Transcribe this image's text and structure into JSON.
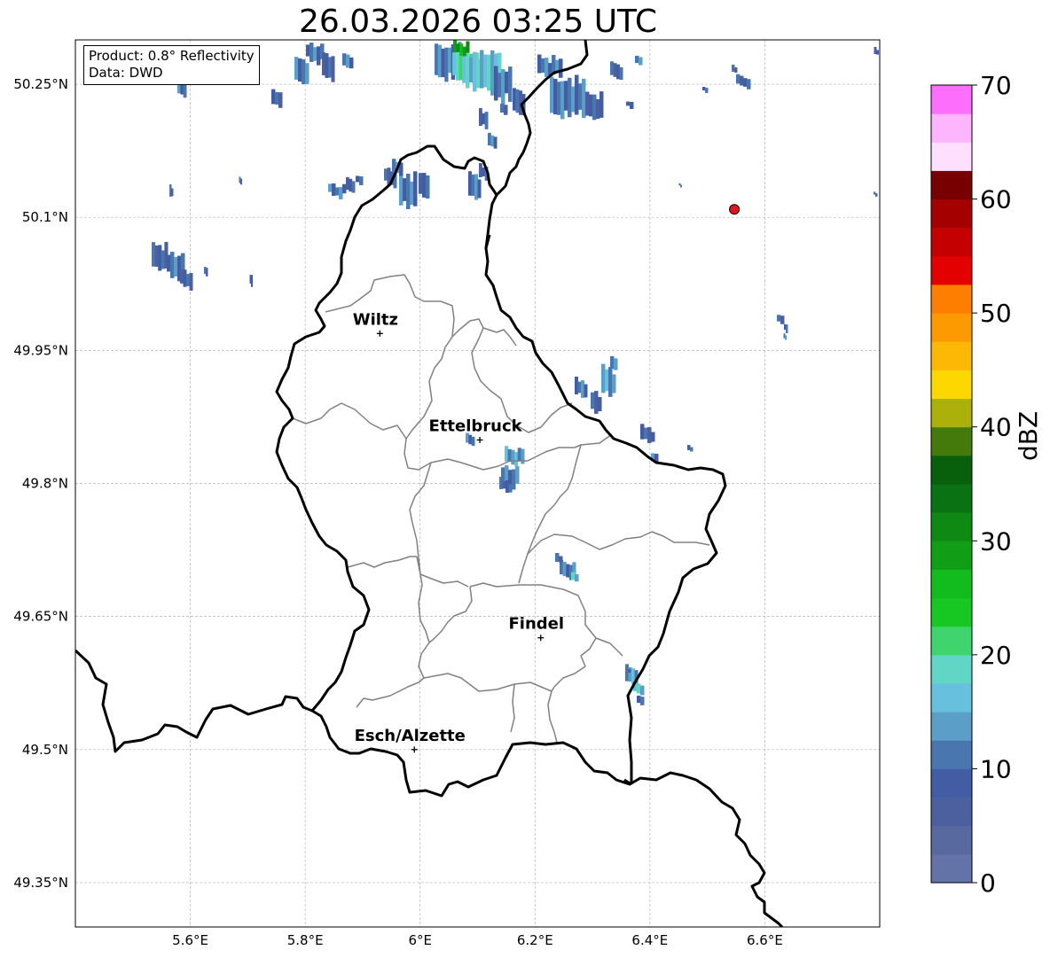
{
  "title": "26.03.2026 03:25 UTC",
  "info_box": {
    "line1": "Product: 0.8° Reflectivity",
    "line2": "Data: DWD"
  },
  "map": {
    "lon_range": [
      5.4,
      6.8
    ],
    "lat_range": [
      49.3,
      50.3
    ],
    "lon_ticks": [
      {
        "value": 5.6,
        "label": "5.6°E"
      },
      {
        "value": 5.8,
        "label": "5.8°E"
      },
      {
        "value": 6.0,
        "label": "6°E"
      },
      {
        "value": 6.2,
        "label": "6.2°E"
      },
      {
        "value": 6.4,
        "label": "6.4°E"
      },
      {
        "value": 6.6,
        "label": "6.6°E"
      }
    ],
    "lat_ticks": [
      {
        "value": 50.25,
        "label": "50.25°N"
      },
      {
        "value": 50.1,
        "label": "50.1°N"
      },
      {
        "value": 49.95,
        "label": "49.95°N"
      },
      {
        "value": 49.8,
        "label": "49.8°N"
      },
      {
        "value": 49.65,
        "label": "49.65°N"
      },
      {
        "value": 49.5,
        "label": "49.5°N"
      },
      {
        "value": 49.35,
        "label": "49.35°N"
      }
    ],
    "cities": [
      {
        "name": "Wiltz",
        "lon": 5.93,
        "lat": 49.969
      },
      {
        "name": "Ettelbruck",
        "lon": 6.104,
        "lat": 49.849
      },
      {
        "name": "Findel",
        "lon": 6.21,
        "lat": 49.626
      },
      {
        "name": "Esch/Alzette",
        "lon": 5.99,
        "lat": 49.5
      }
    ],
    "radar_site": {
      "lon": 6.547,
      "lat": 50.109,
      "color": "#e8141c"
    },
    "grid": true
  },
  "colorbar": {
    "label": "dBZ",
    "min": 0,
    "max": 70,
    "step": 2.5,
    "ticks": [
      {
        "value": 0,
        "label": "0"
      },
      {
        "value": 10,
        "label": "10"
      },
      {
        "value": 20,
        "label": "20"
      },
      {
        "value": 30,
        "label": "30"
      },
      {
        "value": 40,
        "label": "40"
      },
      {
        "value": 50,
        "label": "50"
      },
      {
        "value": 60,
        "label": "60"
      },
      {
        "value": 70,
        "label": "70"
      }
    ],
    "colors": [
      "#6373a8",
      "#5869a0",
      "#4c60a0",
      "#425da3",
      "#4a76b0",
      "#5b9fc8",
      "#66c0de",
      "#62d6c6",
      "#3fd46e",
      "#18c822",
      "#12bb1e",
      "#109e16",
      "#0e8a14",
      "#0a7212",
      "#08600c",
      "#447a0c",
      "#acb00a",
      "#fdd800",
      "#fdb705",
      "#fd9a02",
      "#fd7e00",
      "#e30000",
      "#c40000",
      "#a50000",
      "#790000",
      "#fee0fe",
      "#fdb5fd",
      "#fd6efd",
      "#ea38ea"
    ]
  }
}
